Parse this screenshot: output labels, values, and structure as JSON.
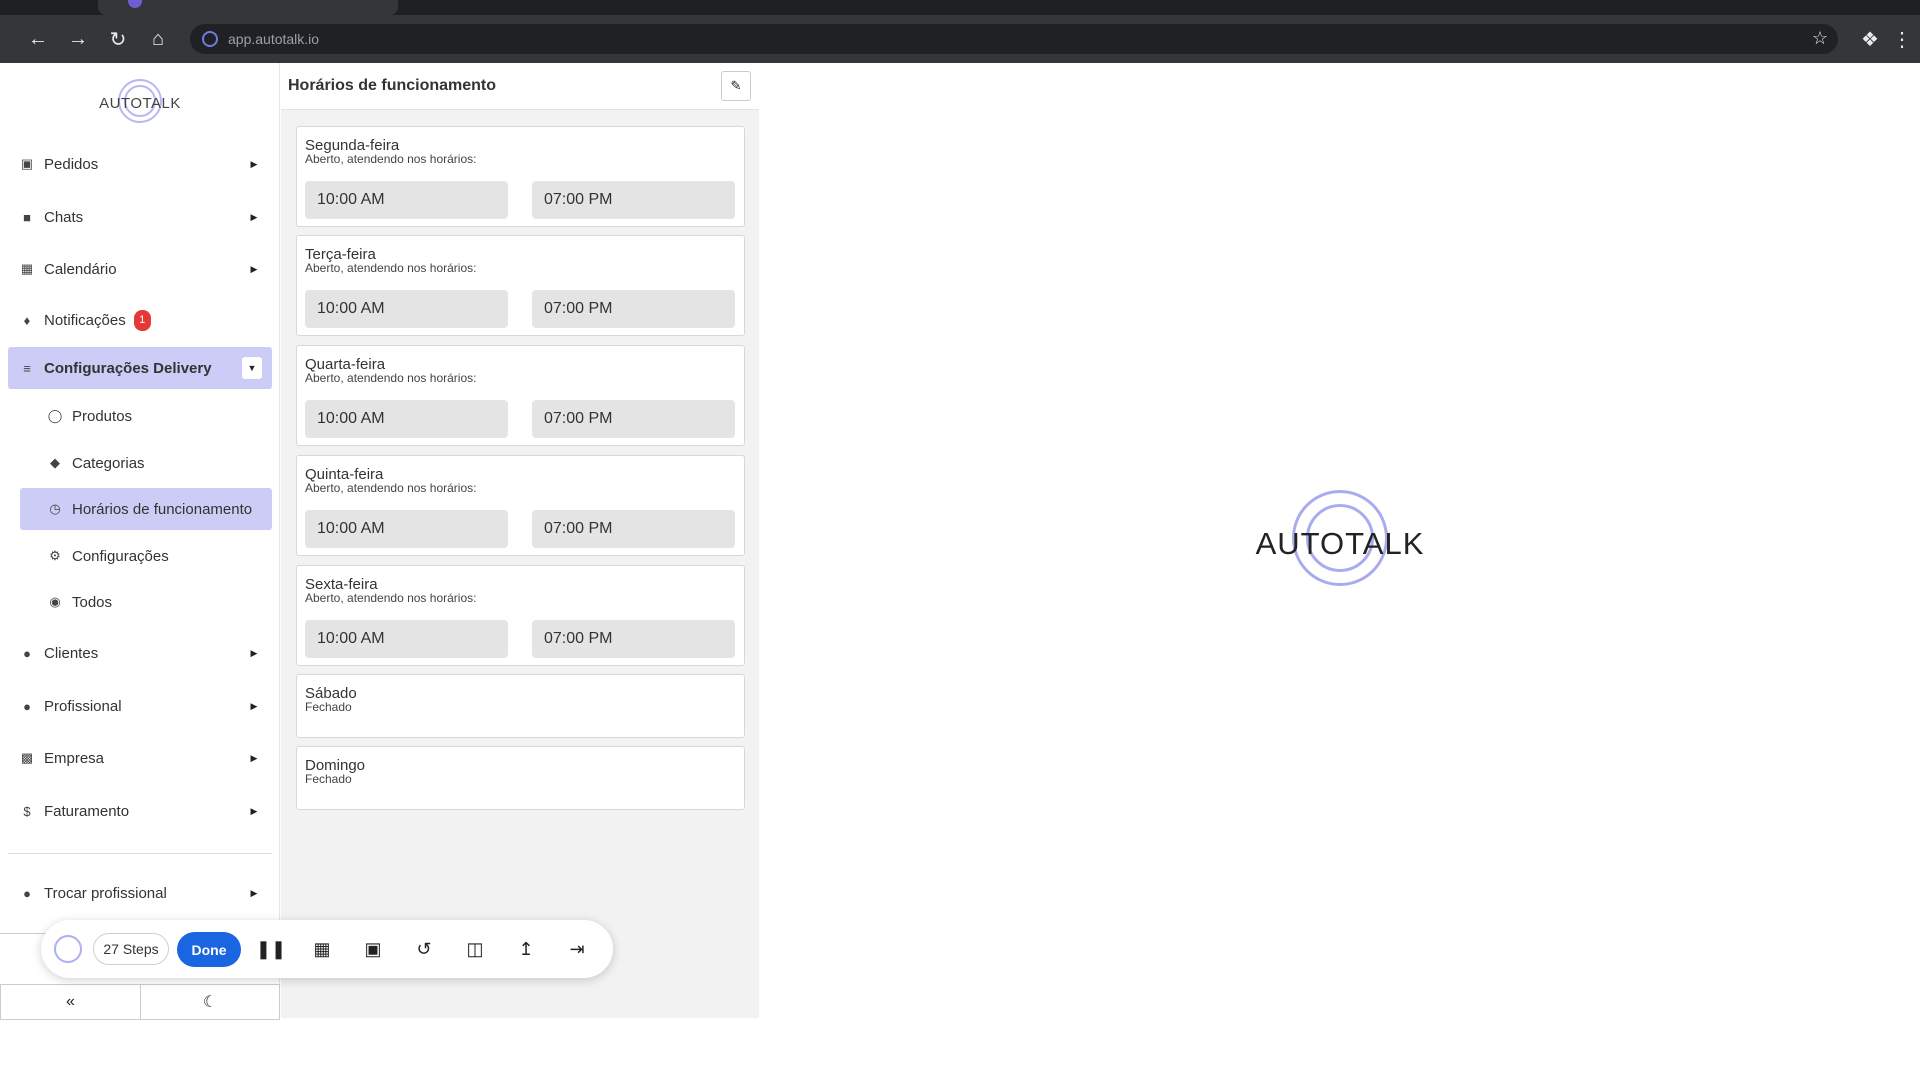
{
  "browser": {
    "url": "app.autotalk.io"
  },
  "sidebar": {
    "logo_text": "AUTOTALK",
    "items": [
      {
        "label": "Pedidos",
        "icon": "clipboard-icon"
      },
      {
        "label": "Chats",
        "icon": "chat-icon"
      },
      {
        "label": "Calendário",
        "icon": "calendar-icon"
      },
      {
        "label": "Notificações",
        "icon": "bell-icon",
        "badge": "1"
      },
      {
        "label": "Configurações Delivery",
        "icon": "sliders-icon"
      }
    ],
    "sub_items": [
      {
        "label": "Produtos",
        "icon": "bottle-icon"
      },
      {
        "label": "Categorias",
        "icon": "tag-icon"
      },
      {
        "label": "Horários de funcionamento",
        "icon": "clock-icon"
      },
      {
        "label": "Configurações",
        "icon": "gear-icon"
      },
      {
        "label": "Todos",
        "icon": "globe-icon"
      }
    ],
    "items_after": [
      {
        "label": "Clientes",
        "icon": "users-icon"
      },
      {
        "label": "Profissional",
        "icon": "user-gear-icon"
      },
      {
        "label": "Empresa",
        "icon": "building-icon"
      },
      {
        "label": "Faturamento",
        "icon": "dollar-icon"
      }
    ],
    "switch_item": {
      "label": "Trocar profissional",
      "icon": "users-cog-icon"
    }
  },
  "panel": {
    "title": "Horários de funcionamento",
    "days": [
      {
        "name": "Segunda-feira",
        "status": "Aberto, atendendo nos horários:",
        "open": "10:00 AM",
        "close": "07:00 PM"
      },
      {
        "name": "Terça-feira",
        "status": "Aberto, atendendo nos horários:",
        "open": "10:00 AM",
        "close": "07:00 PM"
      },
      {
        "name": "Quarta-feira",
        "status": "Aberto, atendendo nos horários:",
        "open": "10:00 AM",
        "close": "07:00 PM"
      },
      {
        "name": "Quinta-feira",
        "status": "Aberto, atendendo nos horários:",
        "open": "10:00 AM",
        "close": "07:00 PM"
      },
      {
        "name": "Sexta-feira",
        "status": "Aberto, atendendo nos horários:",
        "open": "10:00 AM",
        "close": "07:00 PM"
      },
      {
        "name": "Sábado",
        "status": "Fechado"
      },
      {
        "name": "Domingo",
        "status": "Fechado"
      }
    ]
  },
  "splash": {
    "text": "AUTOTALK"
  },
  "recorder": {
    "steps_label": "27 Steps",
    "done_label": "Done"
  }
}
